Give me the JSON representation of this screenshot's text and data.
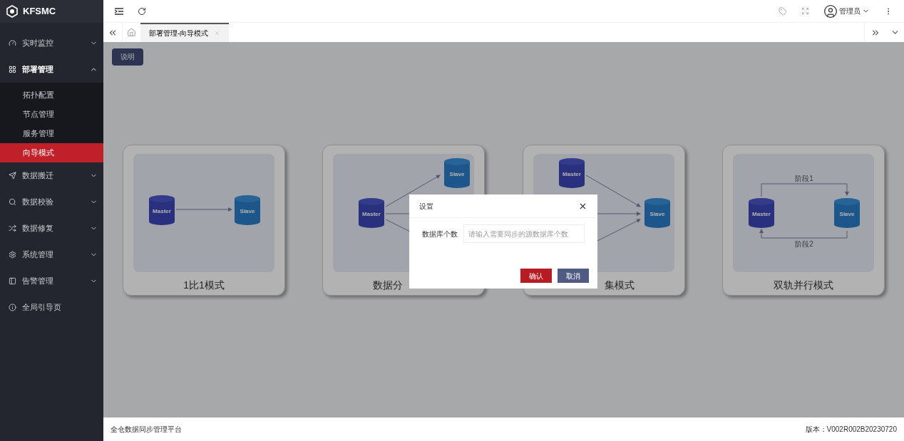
{
  "brand": "KFSMC",
  "sidebar": {
    "items": [
      {
        "label": "实时监控",
        "expanded": false
      },
      {
        "label": "部署管理",
        "expanded": true,
        "children": [
          {
            "label": "拓扑配置",
            "selected": false
          },
          {
            "label": "节点管理",
            "selected": false
          },
          {
            "label": "服务管理",
            "selected": false
          },
          {
            "label": "向导模式",
            "selected": true
          }
        ]
      },
      {
        "label": "数据搬迁",
        "expanded": false
      },
      {
        "label": "数据校验",
        "expanded": false
      },
      {
        "label": "数据修复",
        "expanded": false
      },
      {
        "label": "系统管理",
        "expanded": false
      },
      {
        "label": "告警管理",
        "expanded": false
      },
      {
        "label": "全局引导页"
      }
    ]
  },
  "header": {
    "user": "管理员"
  },
  "tabs": [
    {
      "label": "部署管理-向导模式",
      "selected": true
    }
  ],
  "help_button": "说明",
  "modes": [
    {
      "kind": "one_to_one",
      "title": "1比1模式",
      "nodes": [
        "Master",
        "Slave"
      ]
    },
    {
      "kind": "distribute",
      "title": "数据分",
      "nodes": [
        "Master",
        "Slave"
      ]
    },
    {
      "kind": "collect",
      "title": "集模式",
      "nodes": [
        "Master",
        "Slave"
      ]
    },
    {
      "kind": "dual",
      "title": "双轨并行模式",
      "nodes": [
        "Master",
        "Slave"
      ],
      "stages": [
        "阶段1",
        "阶段2"
      ]
    }
  ],
  "dialog": {
    "title": "设置",
    "field_label": "数据库个数",
    "placeholder": "请输入需要同步的源数据库个数",
    "confirm": "确认",
    "cancel": "取消"
  },
  "footer": {
    "left": "全仓数据同步管理平台",
    "right": "版本：V002R002B20230720"
  }
}
